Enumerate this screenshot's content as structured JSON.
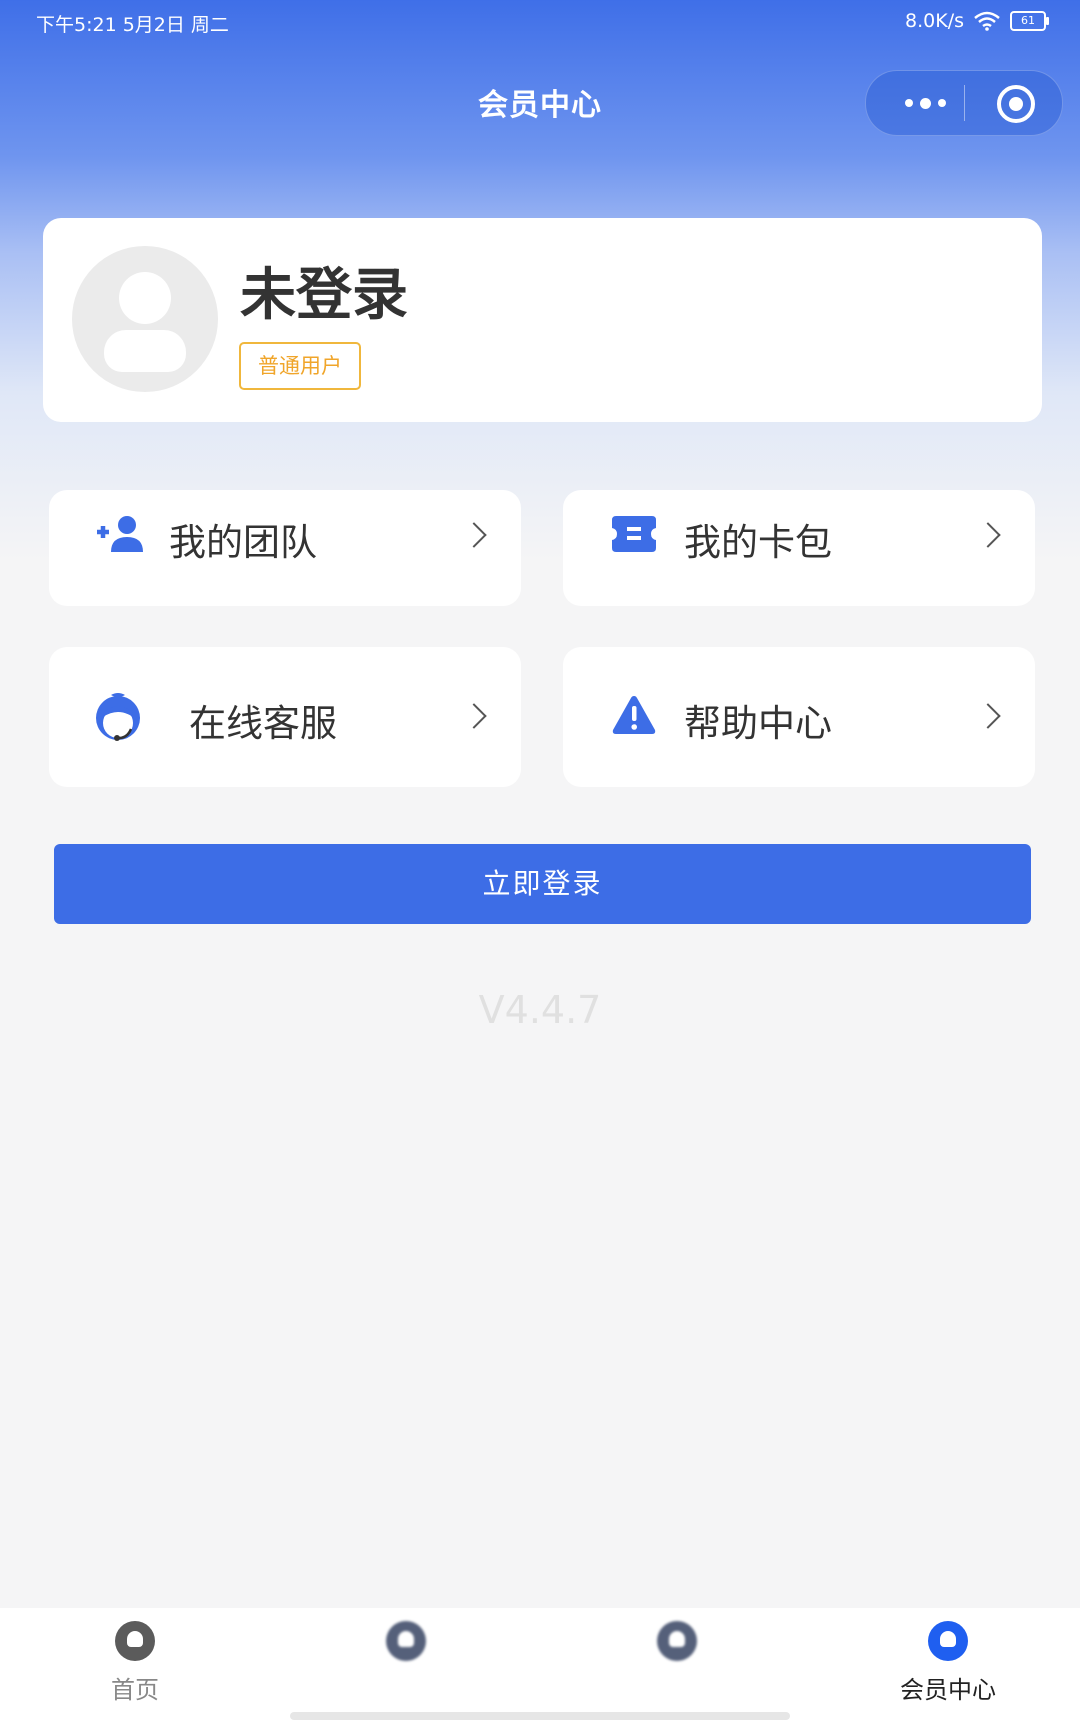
{
  "status_bar": {
    "time": "下午5:21  5月2日 周二",
    "network_speed": "8.0K/s",
    "battery": "61"
  },
  "header": {
    "title": "会员中心"
  },
  "profile": {
    "name": "未登录",
    "badge": "普通用户"
  },
  "menu": {
    "team": {
      "label": "我的团队",
      "icon": "add-user-icon"
    },
    "wallet": {
      "label": "我的卡包",
      "icon": "card-wallet-icon"
    },
    "service": {
      "label": "在线客服",
      "icon": "customer-service-icon"
    },
    "help": {
      "label": "帮助中心",
      "icon": "warning-icon"
    }
  },
  "login_button": "立即登录",
  "version": "V4.4.7",
  "tabs": [
    {
      "label": "首页",
      "icon": "home-icon"
    },
    {
      "label": "",
      "icon": "tab-icon"
    },
    {
      "label": "",
      "icon": "tab-icon"
    },
    {
      "label": "会员中心",
      "icon": "member-icon"
    }
  ],
  "colors": {
    "primary": "#3d6de6",
    "badge": "#f0a52a",
    "background": "#f5f5f6"
  }
}
